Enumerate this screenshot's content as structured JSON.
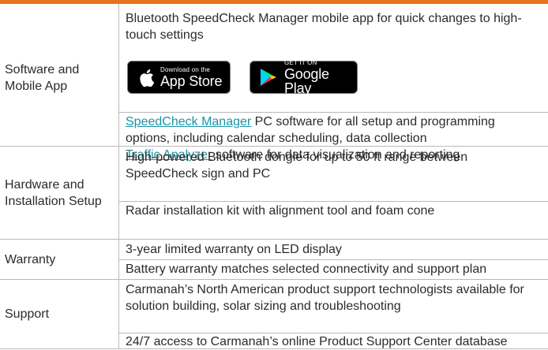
{
  "rows": {
    "software": {
      "label": "Software and Mobile App",
      "app_text": "Bluetooth SpeedCheck Manager mobile app for quick changes to high-touch settings",
      "app_store": {
        "small": "Download on the",
        "big": "App Store"
      },
      "google_play": {
        "small": "GET IT ON",
        "big": "Google Play"
      },
      "pc_link": "SpeedCheck Manager",
      "pc_text": " PC software for all setup and programming options, including calendar scheduling, data collection",
      "analyzer_link": "Traffic Analyzer",
      "analyzer_text": " software for data visualization and reporting"
    },
    "hardware": {
      "label": "Hardware and Installation Setup",
      "dongle": "High-powered Bluetooth dongle for up to 50 ft range between SpeedCheck sign and PC",
      "radar_kit": "Radar installation kit with alignment tool and foam cone"
    },
    "warranty": {
      "label": "Warranty",
      "led": "3-year limited warranty on LED display",
      "battery": "Battery warranty matches selected connectivity and support plan"
    },
    "support": {
      "label": "Support",
      "technologists": "Carmanah’s North American product support technologists available for solution building, solar sizing and troubleshooting",
      "portal": "24/7 access to Carmanah’s online Product Support Center database"
    }
  },
  "colors": {
    "accent": "#e8731e",
    "link": "#1a94a6",
    "border": "#b9b9b9"
  }
}
